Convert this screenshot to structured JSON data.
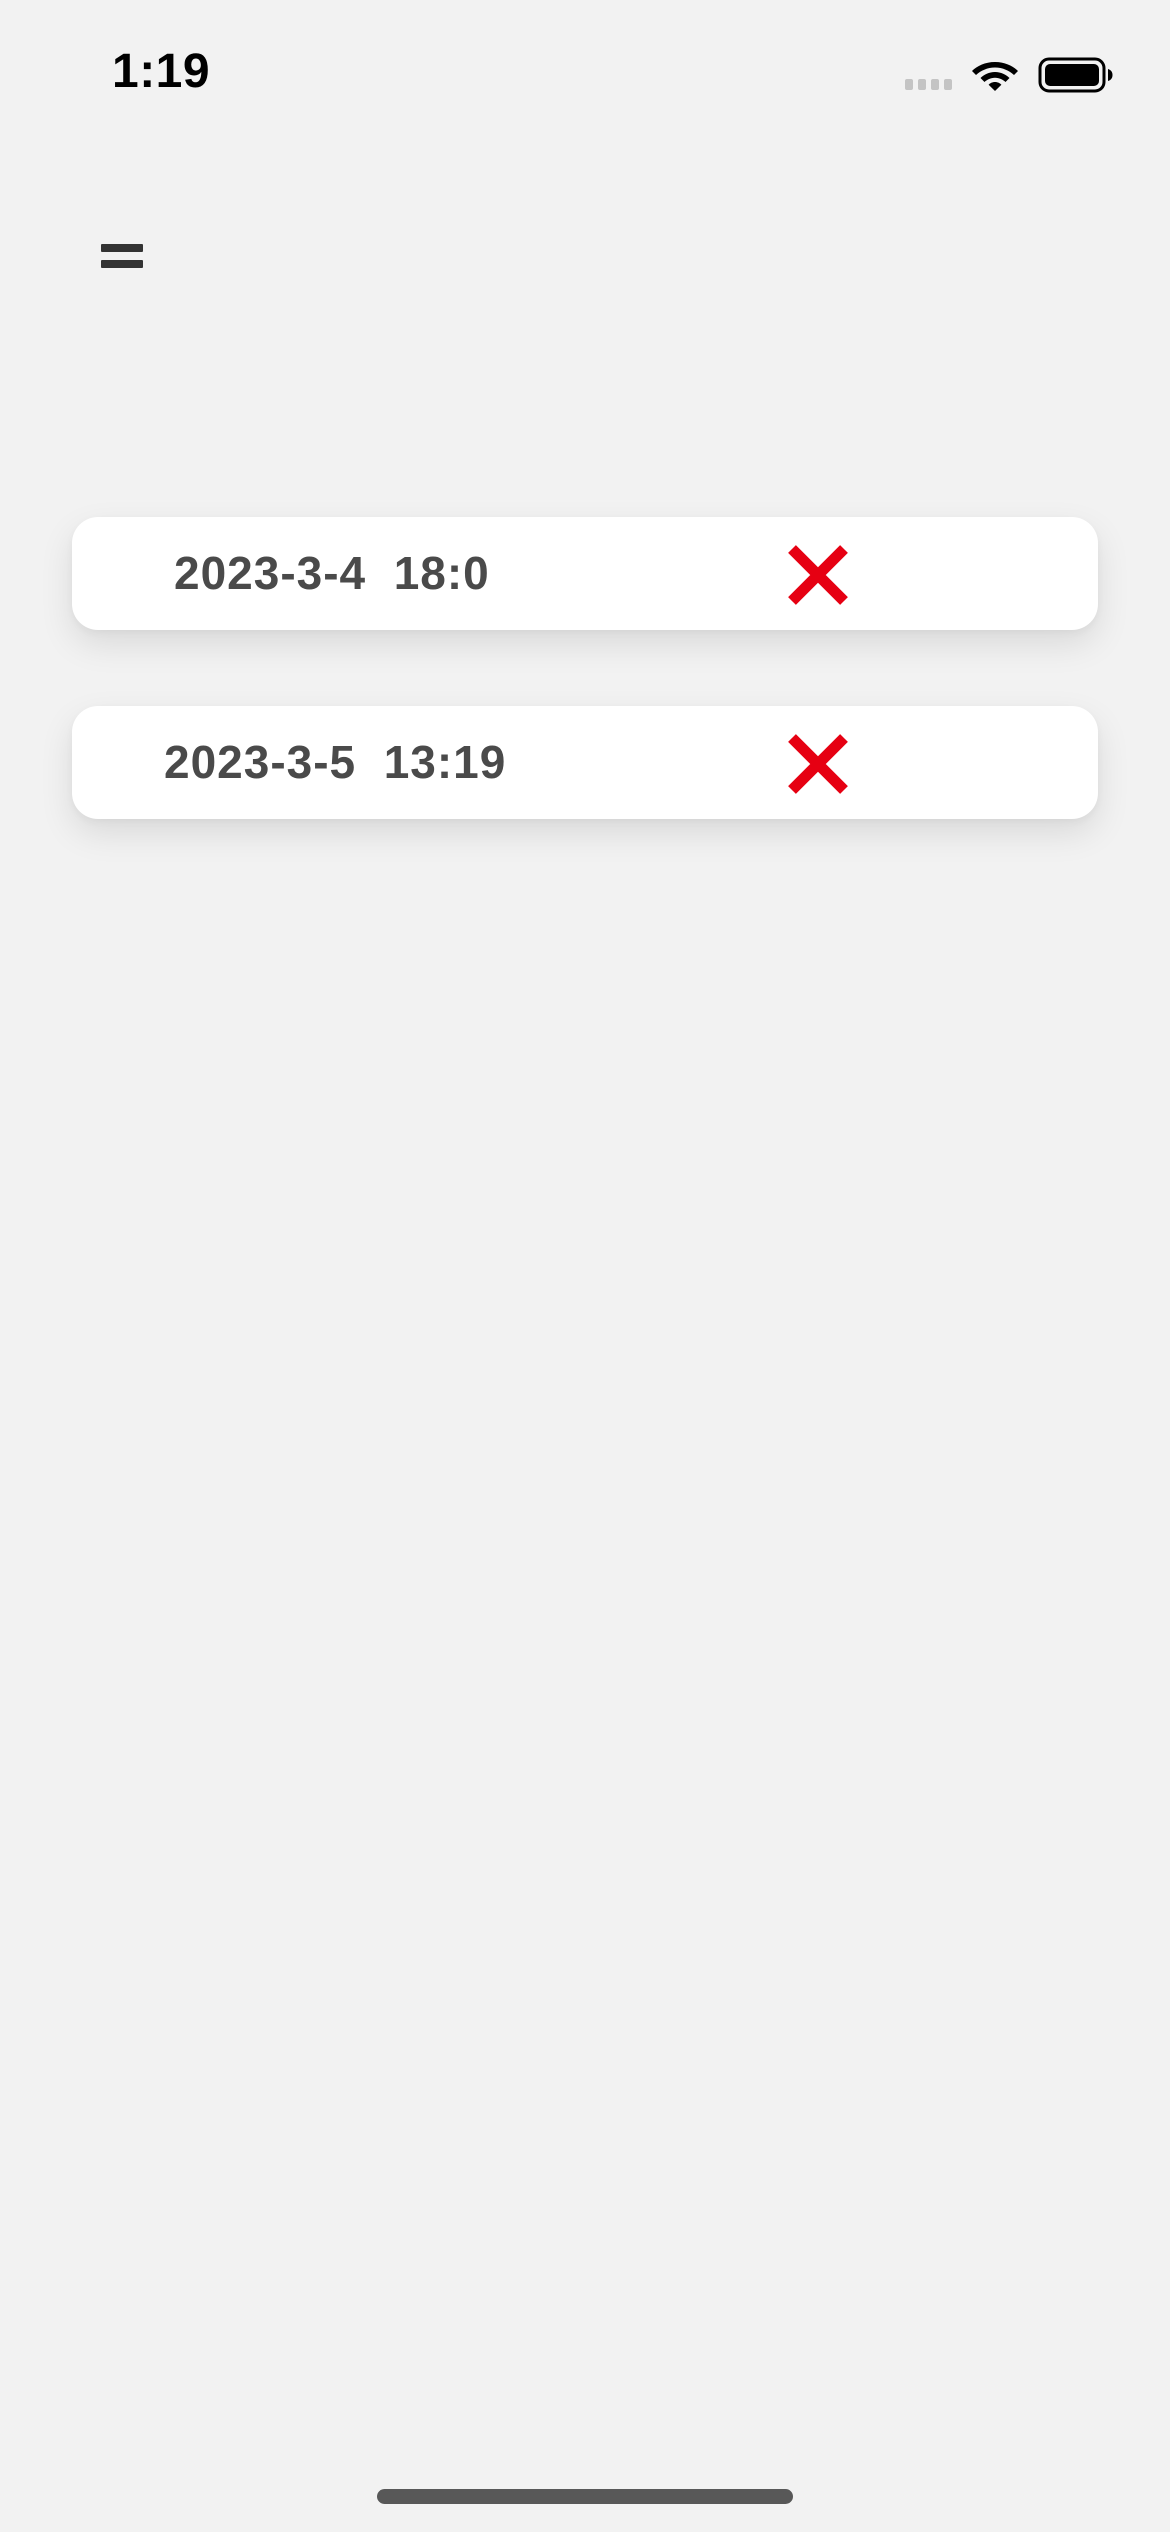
{
  "status_bar": {
    "time": "1:19"
  },
  "header": {
    "menu_icon": "menu-icon"
  },
  "records": [
    {
      "datetime": "2023-3-4  18:0",
      "delete_icon": "close-icon",
      "delete_color": "#e60012"
    },
    {
      "datetime": "2023-3-5  13:19",
      "delete_icon": "close-icon",
      "delete_color": "#e60012"
    }
  ]
}
